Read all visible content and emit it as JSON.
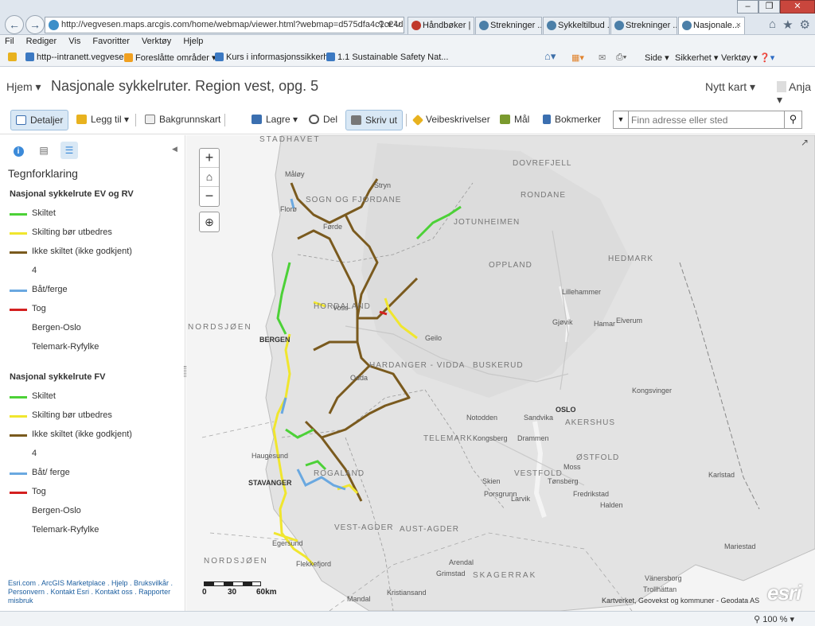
{
  "browser": {
    "url": "http://vegvesen.maps.arcgis.com/home/webmap/viewer.html?webmap=d575dfa4c1c24d16",
    "tabs": [
      {
        "label": "Håndbøker | ...",
        "active": false
      },
      {
        "label": "Strekninger ...",
        "active": false
      },
      {
        "label": "Sykkeltilbud ...",
        "active": false
      },
      {
        "label": "Strekninger ...",
        "active": false
      },
      {
        "label": "Nasjonale...",
        "active": true
      }
    ],
    "menu": [
      "Fil",
      "Rediger",
      "Vis",
      "Favoritter",
      "Verktøy",
      "Hjelp"
    ],
    "favorites": [
      "http--intranett.vegvesen",
      "Foreslåtte områder ▾",
      "Kurs i informasjonssikkerh...",
      "1.1 Sustainable Safety  Nat..."
    ],
    "commands": [
      "Side ▾",
      "Sikkerhet ▾",
      "Verktøy ▾"
    ],
    "zoom": "100 %"
  },
  "header": {
    "home": "Hjem ▾",
    "title": "Nasjonale sykkelruter. Region vest, opg. 5",
    "new_map": "Nytt kart ▾",
    "user": "Anja ▾"
  },
  "toolbar": {
    "details": "Detaljer",
    "add": "Legg til ▾",
    "basemap": "Bakgrunnskart",
    "save": "Lagre ▾",
    "share": "Del",
    "print": "Skriv ut",
    "directions": "Veibeskrivelser",
    "measure": "Mål",
    "bookmarks": "Bokmerker",
    "search_placeholder": "Finn adresse eller sted"
  },
  "legend": {
    "title": "Tegnforklaring",
    "groups": [
      {
        "title": "Nasjonal sykkelrute EV og RV",
        "items": [
          {
            "label": "Skiltet",
            "color": "#4cd137"
          },
          {
            "label": "Skilting bør utbedres",
            "color": "#f0e62e"
          },
          {
            "label": "Ikke skiltet (ikke godkjent)",
            "color": "#7a5a1e"
          },
          {
            "label": "4",
            "color": ""
          },
          {
            "label": "Båt/ferge",
            "color": "#6aa8e0"
          },
          {
            "label": "Tog",
            "color": "#d42020"
          },
          {
            "label": "Bergen-Oslo",
            "color": ""
          },
          {
            "label": "Telemark-Ryfylke",
            "color": ""
          }
        ]
      },
      {
        "title": "Nasjonal sykkelrute FV",
        "items": [
          {
            "label": "Skiltet",
            "color": "#4cd137"
          },
          {
            "label": "Skilting bør utbedres",
            "color": "#f0e62e"
          },
          {
            "label": "Ikke skiltet (ikke godkjent)",
            "color": "#7a5a1e"
          },
          {
            "label": "4",
            "color": ""
          },
          {
            "label": "Båt/ ferge",
            "color": "#6aa8e0"
          },
          {
            "label": "Tog",
            "color": "#d42020"
          },
          {
            "label": "Bergen-Oslo",
            "color": ""
          },
          {
            "label": "Telemark-Ryfylke",
            "color": ""
          }
        ]
      }
    ],
    "footer": "Esri.com . ArcGIS Marketplace . Hjelp . Bruksvilkår . Personvern . Kontakt Esri . Kontakt oss . Rapporter misbruk"
  },
  "map": {
    "labels": {
      "stadhavet": "STADHAVET",
      "nordsjoen1": "NORDSJØEN",
      "nordsjoen2": "NORDSJØEN",
      "skagerrak": "SKAGERRAK",
      "sogn": "SOGN OG FJORDANE",
      "hordaland": "HORDALAND",
      "rogaland": "ROGALAND",
      "vestagder": "VEST-AGDER",
      "austagder": "AUST-AGDER",
      "telemark": "TELEMARK",
      "buskerud": "BUSKERUD",
      "oppland": "OPPLAND",
      "hedmark": "HEDMARK",
      "ostfold": "ØSTFOLD",
      "akershus": "AKERSHUS",
      "vestfold": "VESTFOLD",
      "jotunheimen": "JOTUNHEIMEN",
      "hardanger": "HARDANGER - VIDDA",
      "rondane": "RONDANE",
      "dovrefjell": "DOVREFJELL",
      "bergen": "BERGEN",
      "stavanger": "STAVANGER",
      "oslo": "OSLO",
      "haugesund": "Haugesund",
      "egersund": "Egersund",
      "flekkefjord": "Flekkefjord",
      "mandal": "Mandal",
      "kristiansand": "Kristiansand",
      "arendal": "Arendal",
      "grimstad": "Grimstad",
      "larvik": "Larvik",
      "tonsberg": "Tønsberg",
      "drammen": "Drammen",
      "kongsberg": "Kongsberg",
      "lillehammer": "Lillehammer",
      "hamar": "Hamar",
      "elverum": "Elverum",
      "gjovik": "Gjøvik",
      "geilo": "Geilo",
      "voss": "Voss",
      "odda": "Odda",
      "floro": "Florø",
      "forde": "Førde",
      "stryn": "Stryn",
      "maloy": "Måløy",
      "fredrikstad": "Fredrikstad",
      "halden": "Halden",
      "moss": "Moss",
      "karlstad": "Karlstad",
      "trollhattan": "Trollhättan",
      "vannersborg": "Vänersborg",
      "mariestad": "Mariestad",
      "kongsvinger": "Kongsvinger",
      "sandvika": "Sandvika",
      "porsgrunn": "Porsgrunn",
      "skien": "Skien",
      "notodden": "Notodden"
    },
    "scale": {
      "s0": "0",
      "s30": "30",
      "s60": "60km"
    },
    "attribution": "Kartverket, Geovekst og kommuner - Geodata AS",
    "esri": "esri"
  }
}
